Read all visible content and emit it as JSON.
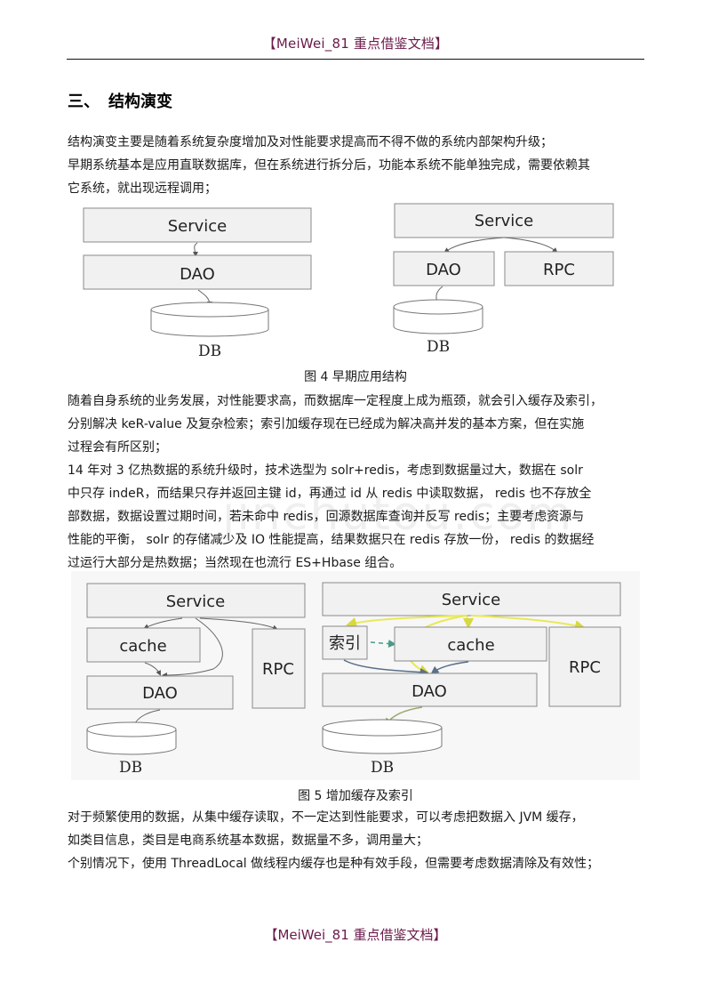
{
  "header": {
    "text": "【MeiWei_81 重点借鉴文档】"
  },
  "footer": {
    "text": "【MeiWei_81 重点借鉴文档】"
  },
  "section": {
    "number": "三、",
    "title": "结构演变"
  },
  "paragraphs": {
    "intro": [
      "结构演变主要是随着系统复杂度增加及对性能要求提高而不得不做的系统内部架构升级；",
      "早期系统基本是应用直联数据库，但在系统进行拆分后，功能本系统不能单独完成，需要依赖其",
      "它系统，就出现远程调用；"
    ],
    "cache_index": [
      "随着自身系统的业务发展，对性能要求高，而数据库一定程度上成为瓶颈，就会引入缓存及索引，",
      "分别解决  keR-value 及复杂检索；索引加缓存现在已经成为解决高并发的基本方案，但在实施",
      "过程会有所区别；",
      "14 年对 3 亿热数据的系统升级时，技术选型为   solr+redis，考虑到数据量过大，数据在  solr",
      "中只存 indeR，而结果只存并返回主键  id，再通过 id 从 redis 中读取数据， redis 也不存放全",
      "部数据，数据设置过期时间，若未命中  redis，回源数据库查询并反写  redis；主要考虑资源与",
      "性能的平衡， solr 的存储减少及 IO 性能提高，结果数据只在  redis 存放一份， redis 的数据经",
      "过运行大部分是热数据；当然现在也流行   ES+Hbase 组合。"
    ],
    "jvm": [
      "对于频繁使用的数据，从集中缓存读取，不一定达到性能要求，可以考虑把数据入    JVM 缓存，",
      "如类目信息，类目是电商系统基本数据，数据量不多，调用量大；",
      "个别情况下，使用  ThreadLocal 做线程内缓存也是种有效手段，但需要考虑数据清除及有效性；"
    ]
  },
  "watermark": "jinchutou.com",
  "figures": {
    "fig4": {
      "caption": "图 4 早期应用结构",
      "left": {
        "service": "Service",
        "dao": "DAO",
        "db": "DB"
      },
      "right": {
        "service": "Service",
        "dao": "DAO",
        "rpc": "RPC",
        "db": "DB"
      }
    },
    "fig5": {
      "caption": "图 5 增加缓存及索引",
      "left": {
        "service": "Service",
        "cache": "cache",
        "dao": "DAO",
        "rpc": "RPC",
        "db": "DB"
      },
      "right": {
        "service": "Service",
        "index": "索引",
        "cache": "cache",
        "dao": "DAO",
        "rpc": "RPC",
        "db": "DB"
      }
    }
  },
  "colors": {
    "header_text": "#6b1a4a",
    "box_fill": "#f1f1f1",
    "box_stroke": "#8a8a8a",
    "arrow": "#666666",
    "highlight_arrow": "#e8e85a",
    "index_arrow": "#4a9a8a",
    "blue_arrow": "#5a6f8a"
  }
}
